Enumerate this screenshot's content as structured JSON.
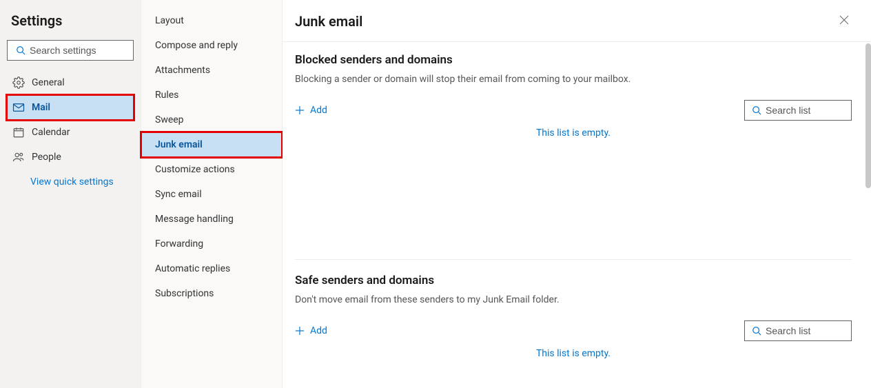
{
  "sidebar": {
    "title": "Settings",
    "search_placeholder": "Search settings",
    "items": [
      {
        "label": "General"
      },
      {
        "label": "Mail"
      },
      {
        "label": "Calendar"
      },
      {
        "label": "People"
      }
    ],
    "quick_settings_label": "View quick settings"
  },
  "subnav": {
    "items": [
      {
        "label": "Layout"
      },
      {
        "label": "Compose and reply"
      },
      {
        "label": "Attachments"
      },
      {
        "label": "Rules"
      },
      {
        "label": "Sweep"
      },
      {
        "label": "Junk email"
      },
      {
        "label": "Customize actions"
      },
      {
        "label": "Sync email"
      },
      {
        "label": "Message handling"
      },
      {
        "label": "Forwarding"
      },
      {
        "label": "Automatic replies"
      },
      {
        "label": "Subscriptions"
      }
    ]
  },
  "main": {
    "title": "Junk email",
    "blocked": {
      "title": "Blocked senders and domains",
      "desc": "Blocking a sender or domain will stop their email from coming to your mailbox.",
      "add_label": "Add",
      "search_placeholder": "Search list",
      "empty_msg": "This list is empty."
    },
    "safe": {
      "title": "Safe senders and domains",
      "desc": "Don't move email from these senders to my Junk Email folder.",
      "add_label": "Add",
      "search_placeholder": "Search list",
      "empty_msg": "This list is empty."
    }
  }
}
